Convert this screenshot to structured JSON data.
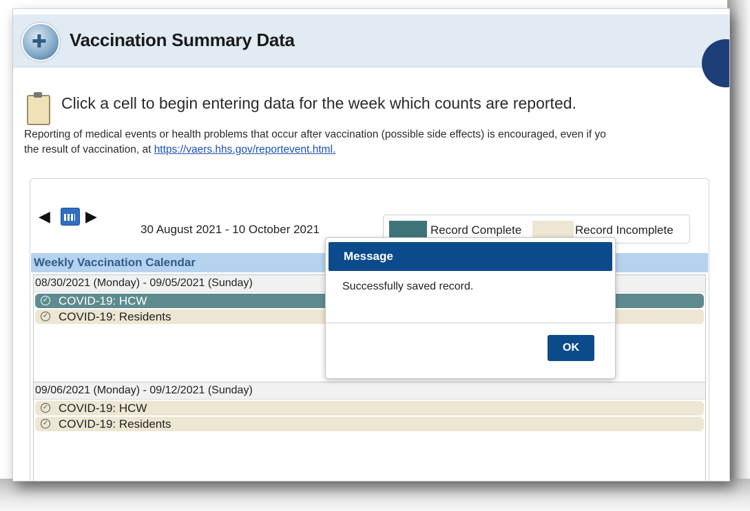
{
  "page": {
    "title": "Vaccination Summary Data",
    "instruction": "Click a cell to begin entering data for the week which counts are reported.",
    "notice_line1": "Reporting of medical events or health problems that occur after vaccination (possible side effects) is encouraged, even if yo",
    "notice_line2_prefix": "the result of vaccination, at ",
    "notice_link": "https://vaers.hhs.gov/reportevent.html."
  },
  "calendar": {
    "date_range": "30 August 2021 - 10 October 2021",
    "header": "Weekly Vaccination Calendar",
    "legend": {
      "complete_label": "Record Complete",
      "incomplete_label": "Record Incomplete",
      "complete_color": "#3f7479",
      "incomplete_color": "#ece6d2"
    },
    "weeks": [
      {
        "title": "08/30/2021 (Monday) - 09/05/2021 (Sunday)",
        "entries": [
          {
            "label": "COVID-19: HCW",
            "status": "complete"
          },
          {
            "label": "COVID-19: Residents",
            "status": "incomplete"
          }
        ]
      },
      {
        "title": "09/06/2021 (Monday) - 09/12/2021 (Sunday)",
        "entries": [
          {
            "label": "COVID-19: HCW",
            "status": "incomplete"
          },
          {
            "label": "COVID-19: Residents",
            "status": "incomplete"
          }
        ]
      }
    ]
  },
  "modal": {
    "title": "Message",
    "body": "Successfully saved record.",
    "ok_label": "OK"
  }
}
